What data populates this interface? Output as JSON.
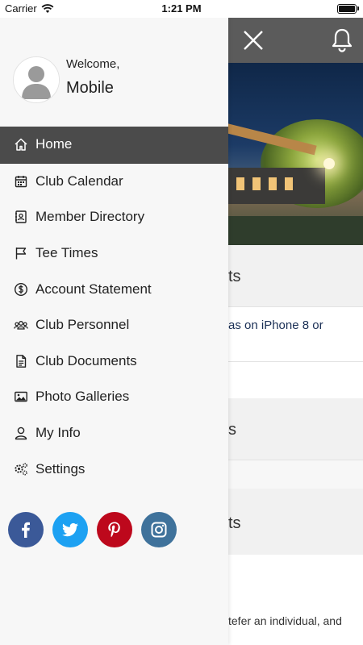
{
  "status_bar": {
    "carrier": "Carrier",
    "time": "1:21 PM"
  },
  "profile": {
    "welcome": "Welcome,",
    "name": "Mobile"
  },
  "menu": {
    "items": [
      {
        "label": "Home",
        "icon": "home-icon",
        "active": true
      },
      {
        "label": "Club Calendar",
        "icon": "calendar-icon",
        "active": false
      },
      {
        "label": "Member Directory",
        "icon": "directory-icon",
        "active": false
      },
      {
        "label": "Tee Times",
        "icon": "flag-icon",
        "active": false
      },
      {
        "label": "Account Statement",
        "icon": "dollar-icon",
        "active": false
      },
      {
        "label": "Club Personnel",
        "icon": "people-icon",
        "active": false
      },
      {
        "label": "Club Documents",
        "icon": "document-icon",
        "active": false
      },
      {
        "label": "Photo Galleries",
        "icon": "photo-icon",
        "active": false
      },
      {
        "label": "My Info",
        "icon": "user-icon",
        "active": false
      },
      {
        "label": "Settings",
        "icon": "settings-icon",
        "active": false
      }
    ]
  },
  "social": [
    {
      "name": "facebook",
      "icon": "facebook-icon",
      "color": "#3b5998"
    },
    {
      "name": "twitter",
      "icon": "twitter-icon",
      "color": "#1da1f2"
    },
    {
      "name": "pinterest",
      "icon": "pinterest-icon",
      "color": "#bd081c"
    },
    {
      "name": "instagram",
      "icon": "instagram-icon",
      "color": "#3f729b"
    }
  ],
  "background": {
    "section1_title": "ts",
    "section2_text": "as on iPhone 8 or",
    "section4_title": "s",
    "section6_title": "ts",
    "section7_text": "tefer an individual, and"
  },
  "colors": {
    "header": "#5b5b5b",
    "active_item": "#4b4b4b",
    "drawer_bg": "#f7f7f7"
  }
}
